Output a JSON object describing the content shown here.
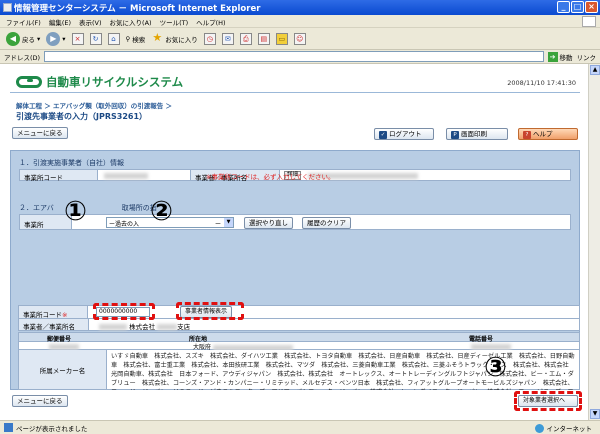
{
  "window": {
    "title": "情報管理センターシステム － Microsoft Internet Explorer",
    "min_glyph": "_",
    "max_glyph": "□",
    "close_glyph": "×"
  },
  "menu": [
    "ファイル(F)",
    "編集(E)",
    "表示(V)",
    "お気に入り(A)",
    "ツール(T)",
    "ヘルプ(H)"
  ],
  "toolbar": {
    "back": "戻る",
    "search": "検索",
    "favorites": "お気に入り"
  },
  "address": {
    "label": "アドレス(D)",
    "go": "移動",
    "links": "リンク"
  },
  "header": {
    "logo": "自動車リサイクルシステム",
    "datetime": "2008/11/10 17:41:30"
  },
  "breadcrumb": "解体工程 ＞ エアバッグ類（取外回収）の引渡報告 ＞",
  "screen_title": "引渡先事業者の入力（JPRS3261）",
  "buttons": {
    "menu_back": "メニューに戻る",
    "logout": "ログアウト",
    "print": "画面印刷",
    "help": "ヘルプ",
    "rollback": "選択やり直し",
    "history_clear": "履歴のクリア",
    "info_display": "事業者情報表示",
    "target_select": "対象業者選択へ"
  },
  "section1": {
    "title": "１．引渡実施事業者（自社）情報",
    "code_label": "事業所コード",
    "name_label": "事業者／事業所名",
    "detail_btn": "詳細"
  },
  "section2": {
    "title": "２．エアバ",
    "title_rest": "取場所の指",
    "required_note": "※事業所コードは、必ず入力してください。",
    "select_label": "事業所",
    "history_combo": "ー過去の入",
    "history_combo_tail": "ー",
    "code_label": "事業所コード",
    "required_mark": "※",
    "code_value": "0000000000",
    "name_label": "事業者／事業所名",
    "name_corp": "株式会社",
    "name_branch": "支店",
    "col_postal": "郵便番号",
    "col_address": "所在地",
    "col_phone": "電話番号",
    "address_prefix": "大阪府",
    "maker_label": "所属メーカー名",
    "maker_text": "いすゞ自動車　株式会社、スズキ　株式会社、ダイハツ工業　株式会社、トヨタ自動車　株式会社、日産自動車　株式会社、日産ディーゼル工業　株式会社、日野自動車　株式会社、富士重工業　株式会社、本田技研工業　株式会社、マツダ　株式会社、三菱自動車工業　株式会社、三菱ふそうトラック・バス　株式会社、株式会社　光岡自動車、株式会社　日本フォード、アウディジャパン　株式会社、株式会社　オートレックス、オートトレーディングルフトジャパン　株式会社、ビー・エム・ダブリュー　株式会社、コーンズ・アンド・カンパニー・リミテッド、メルセデス・ベンツ日本　株式会社、フィアットグループオートモービルズジャパン　株式会社、フォード・ジャパン・リミテッド、ゼネラルモーターズ・アジア・パシフィック・ジャパン　株式会社、ヒュンダイモータージャパン　株式会社、フォーピラーズ、エルシーアイ　株式会社、三井物産オートモーティブ　株式会社、ニコル・レーシング・ジャパン　株式会社、ビー・エー・ジー・インポート　株式会社、ジョン・トロ（ビーエム）カンパニー　株式会社、日本オートモービルズ　株式会社、株式会社　ロールス・ロイス　モーターカーズ　リミテッド、フォルクスワーゲングループジャパン　株式会社、日本ボルボ　株式会社、ピー・エム・ダブリュー　株式会社、クライスラー日本　株式会社、ジャガー・ランドローバー・ジャパン　株式会社、Ｆｅｒｒａｒｉ　Ｊａｐａｎ　株式会社、エンジニアリング　株式会社、株式会社　加藤製作所、株式会社　小松製作所、東急車輛製造　株式会社、日本自動車輸入組合、リサイクル促進センター　再資源化業務"
  },
  "annotations": {
    "one": "①",
    "two": "②",
    "three": "③"
  },
  "status": {
    "text": "ページが表示されました",
    "zone": "インターネット"
  }
}
